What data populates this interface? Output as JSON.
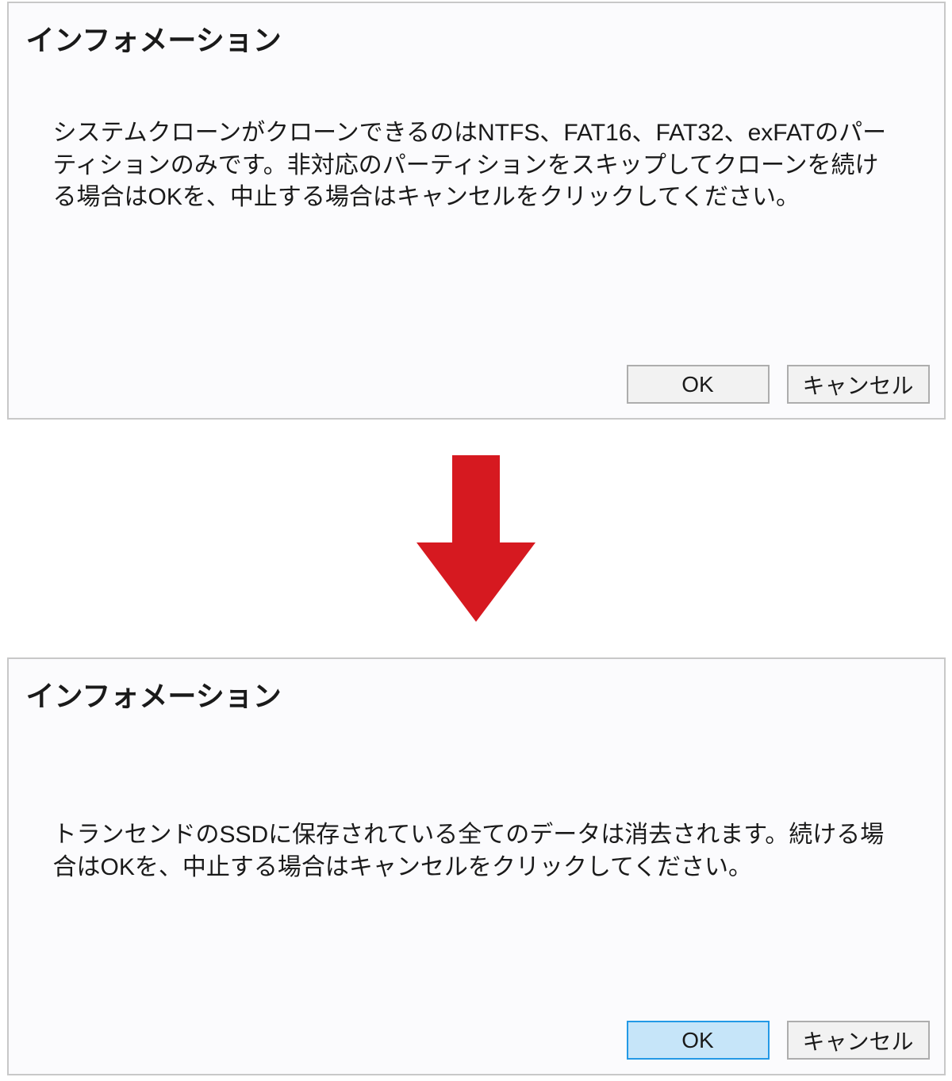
{
  "dialog1": {
    "title": "インフォメーション",
    "message": "システムクローンがクローンできるのはNTFS、FAT16、FAT32、exFATのパーティションのみです。非対応のパーティションをスキップしてクローンを続ける場合はOKを、中止する場合はキャンセルをクリックしてください。",
    "ok_label": "OK",
    "cancel_label": "キャンセル"
  },
  "dialog2": {
    "title": "インフォメーション",
    "message": "トランセンドのSSDに保存されている全てのデータは消去されます。続ける場合はOKを、中止する場合はキャンセルをクリックしてください。",
    "ok_label": "OK",
    "cancel_label": "キャンセル"
  },
  "arrow_color": "#d61920"
}
